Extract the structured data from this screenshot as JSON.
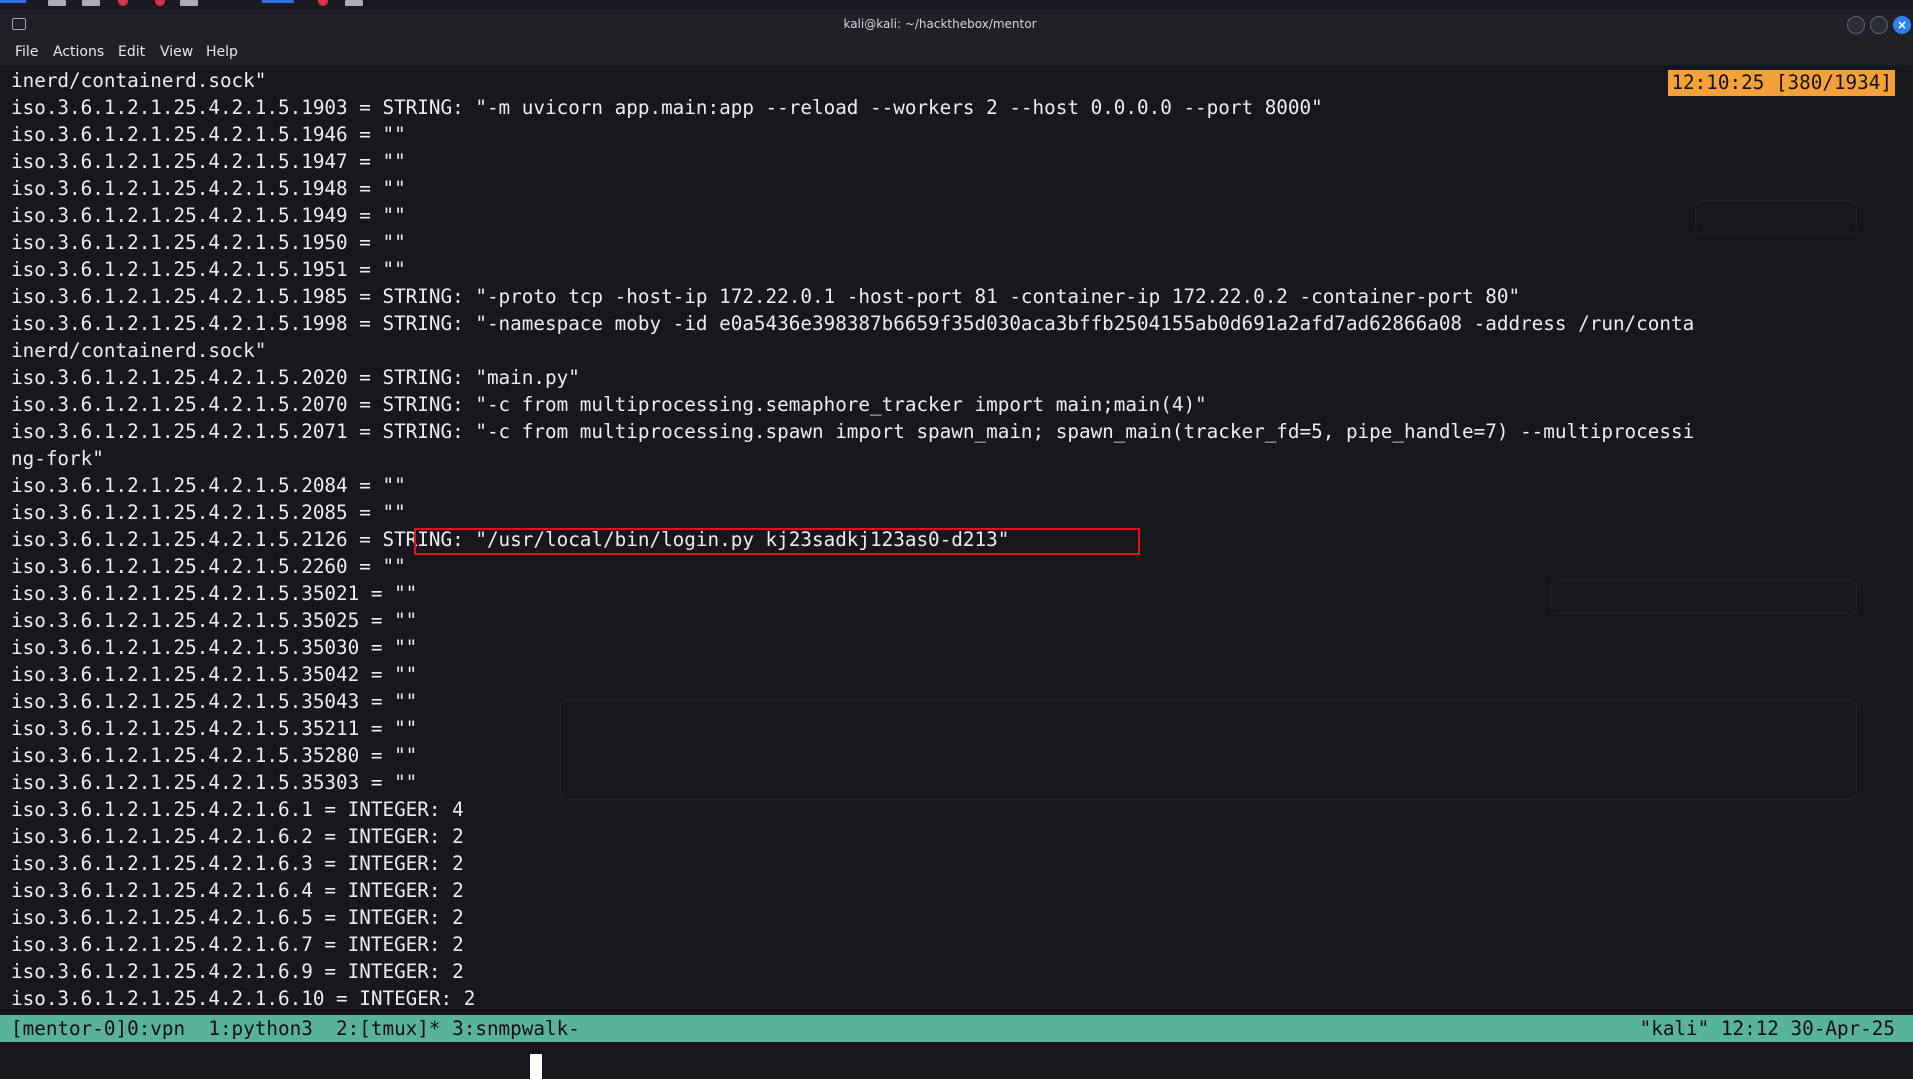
{
  "window": {
    "title": "kali@kali: ~/hackthebox/mentor",
    "close_glyph": "×"
  },
  "menu": {
    "items": [
      "File",
      "Actions",
      "Edit",
      "View",
      "Help"
    ]
  },
  "clock_badge": "12:10:25 [380/1934]",
  "terminal_lines": [
    "inerd/containerd.sock\"",
    "iso.3.6.1.2.1.25.4.2.1.5.1903 = STRING: \"-m uvicorn app.main:app --reload --workers 2 --host 0.0.0.0 --port 8000\"",
    "iso.3.6.1.2.1.25.4.2.1.5.1946 = \"\"",
    "iso.3.6.1.2.1.25.4.2.1.5.1947 = \"\"",
    "iso.3.6.1.2.1.25.4.2.1.5.1948 = \"\"",
    "iso.3.6.1.2.1.25.4.2.1.5.1949 = \"\"",
    "iso.3.6.1.2.1.25.4.2.1.5.1950 = \"\"",
    "iso.3.6.1.2.1.25.4.2.1.5.1951 = \"\"",
    "iso.3.6.1.2.1.25.4.2.1.5.1985 = STRING: \"-proto tcp -host-ip 172.22.0.1 -host-port 81 -container-ip 172.22.0.2 -container-port 80\"",
    "iso.3.6.1.2.1.25.4.2.1.5.1998 = STRING: \"-namespace moby -id e0a5436e398387b6659f35d030aca3bffb2504155ab0d691a2afd7ad62866a08 -address /run/conta",
    "inerd/containerd.sock\"",
    "iso.3.6.1.2.1.25.4.2.1.5.2020 = STRING: \"main.py\"",
    "iso.3.6.1.2.1.25.4.2.1.5.2070 = STRING: \"-c from multiprocessing.semaphore_tracker import main;main(4)\"",
    "iso.3.6.1.2.1.25.4.2.1.5.2071 = STRING: \"-c from multiprocessing.spawn import spawn_main; spawn_main(tracker_fd=5, pipe_handle=7) --multiprocessi",
    "ng-fork\"",
    "iso.3.6.1.2.1.25.4.2.1.5.2084 = \"\"",
    "iso.3.6.1.2.1.25.4.2.1.5.2085 = \"\"",
    "iso.3.6.1.2.1.25.4.2.1.5.2126 = STRING: \"/usr/local/bin/login.py kj23sadkj123as0-d213\"",
    "iso.3.6.1.2.1.25.4.2.1.5.2260 = \"\"",
    "iso.3.6.1.2.1.25.4.2.1.5.35021 = \"\"",
    "iso.3.6.1.2.1.25.4.2.1.5.35025 = \"\"",
    "iso.3.6.1.2.1.25.4.2.1.5.35030 = \"\"",
    "iso.3.6.1.2.1.25.4.2.1.5.35042 = \"\"",
    "iso.3.6.1.2.1.25.4.2.1.5.35043 = \"\"",
    "iso.3.6.1.2.1.25.4.2.1.5.35211 = \"\"",
    "iso.3.6.1.2.1.25.4.2.1.5.35280 = \"\"",
    "iso.3.6.1.2.1.25.4.2.1.5.35303 = \"\"",
    "iso.3.6.1.2.1.25.4.2.1.6.1 = INTEGER: 4",
    "iso.3.6.1.2.1.25.4.2.1.6.2 = INTEGER: 2",
    "iso.3.6.1.2.1.25.4.2.1.6.3 = INTEGER: 2",
    "iso.3.6.1.2.1.25.4.2.1.6.4 = INTEGER: 2",
    "iso.3.6.1.2.1.25.4.2.1.6.5 = INTEGER: 2",
    "iso.3.6.1.2.1.25.4.2.1.6.7 = INTEGER: 2",
    "iso.3.6.1.2.1.25.4.2.1.6.9 = INTEGER: 2",
    "iso.3.6.1.2.1.25.4.2.1.6.10 = INTEGER: 2"
  ],
  "statusbar": {
    "left": "[mentor-0]0:vpn  1:python3  2:[tmux]* 3:snmpwalk-",
    "right": "\"kali\" 12:12 30-Apr-25"
  },
  "colors": {
    "terminal_bg": "#16181d",
    "terminal_fg": "#ecedf0",
    "status_bg": "#59b39b",
    "badge_bg": "#f5a13a",
    "highlight_border": "#e2111f"
  }
}
